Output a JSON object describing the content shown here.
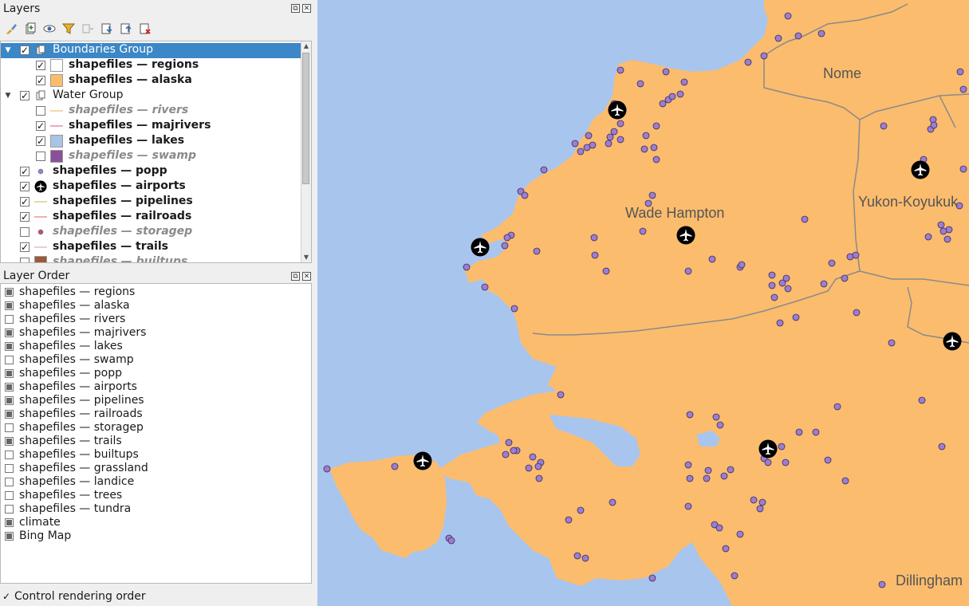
{
  "layers_panel": {
    "title": "Layers",
    "dock_float": "⧉",
    "dock_close": "✕",
    "toolbar": [
      "paint-brush-icon",
      "add-group-icon",
      "eye-icon",
      "filter-icon",
      "filter-legend-icon",
      "expand-all-icon",
      "collapse-all-icon",
      "remove-layer-icon"
    ],
    "tree": [
      {
        "label": "Boundaries Group",
        "type": "group",
        "checked": true,
        "expanded": true,
        "selected": true,
        "indent": 0
      },
      {
        "label": "shapefiles — regions",
        "type": "fill",
        "color": "#ffffff",
        "checked": true,
        "indent": 1,
        "bold": true
      },
      {
        "label": "shapefiles — alaska",
        "type": "fill",
        "color": "#fbbc6e",
        "checked": true,
        "indent": 1,
        "bold": true
      },
      {
        "label": "Water Group",
        "type": "group",
        "checked": true,
        "expanded": true,
        "indent": 0
      },
      {
        "label": "shapefiles — rivers",
        "type": "line",
        "color": "#f3c98a",
        "checked": false,
        "indent": 1
      },
      {
        "label": "shapefiles — majrivers",
        "type": "line",
        "color": "#e48bb3",
        "checked": true,
        "indent": 1,
        "bold": true
      },
      {
        "label": "shapefiles — lakes",
        "type": "fill",
        "color": "#a8c4e6",
        "checked": true,
        "indent": 1,
        "bold": true
      },
      {
        "label": "shapefiles — swamp",
        "type": "fill",
        "color": "#8a4f9b",
        "checked": false,
        "indent": 1
      },
      {
        "label": "shapefiles — popp",
        "type": "point",
        "color": "#9b7ed0",
        "checked": true,
        "indent": 0,
        "bold": true
      },
      {
        "label": "shapefiles — airports",
        "type": "airport",
        "color": "#000000",
        "checked": true,
        "indent": 0,
        "bold": true
      },
      {
        "label": "shapefiles — pipelines",
        "type": "line",
        "color": "#d8d08a",
        "checked": true,
        "indent": 0,
        "bold": true
      },
      {
        "label": "shapefiles — railroads",
        "type": "line",
        "color": "#e89a8a",
        "checked": true,
        "indent": 0,
        "bold": true
      },
      {
        "label": "shapefiles — storagep",
        "type": "point",
        "color": "#c0507a",
        "checked": false,
        "indent": 0
      },
      {
        "label": "shapefiles — trails",
        "type": "line",
        "color": "#e8b8c8",
        "checked": true,
        "indent": 0,
        "bold": true
      },
      {
        "label": "shapefiles — builtups",
        "type": "fill",
        "color": "#9a5a3a",
        "checked": false,
        "indent": 0
      }
    ]
  },
  "order_panel": {
    "title": "Layer Order",
    "items": [
      {
        "label": "shapefiles — regions",
        "on": true
      },
      {
        "label": "shapefiles — alaska",
        "on": true
      },
      {
        "label": "shapefiles — rivers",
        "on": false
      },
      {
        "label": "shapefiles — majrivers",
        "on": true
      },
      {
        "label": "shapefiles — lakes",
        "on": true
      },
      {
        "label": "shapefiles — swamp",
        "on": false
      },
      {
        "label": "shapefiles — popp",
        "on": true
      },
      {
        "label": "shapefiles — airports",
        "on": true
      },
      {
        "label": "shapefiles — pipelines",
        "on": true
      },
      {
        "label": "shapefiles — railroads",
        "on": true
      },
      {
        "label": "shapefiles — storagep",
        "on": false
      },
      {
        "label": "shapefiles — trails",
        "on": true
      },
      {
        "label": "shapefiles — builtups",
        "on": false
      },
      {
        "label": "shapefiles — grassland",
        "on": false
      },
      {
        "label": "shapefiles — landice",
        "on": false
      },
      {
        "label": "shapefiles — trees",
        "on": false
      },
      {
        "label": "shapefiles — tundra",
        "on": false
      },
      {
        "label": "climate",
        "on": true
      },
      {
        "label": "Bing Map",
        "on": true
      }
    ],
    "control_rendering": {
      "label": "Control rendering order",
      "checked": true
    }
  },
  "map": {
    "water_color": "#a8c5ee",
    "land_color": "#fbbc6e",
    "labels": {
      "nome": "Nome",
      "wade": "Wade Hampton",
      "yukon": "Yukon-Koyukuk",
      "dillingham": "Dillingham"
    }
  }
}
